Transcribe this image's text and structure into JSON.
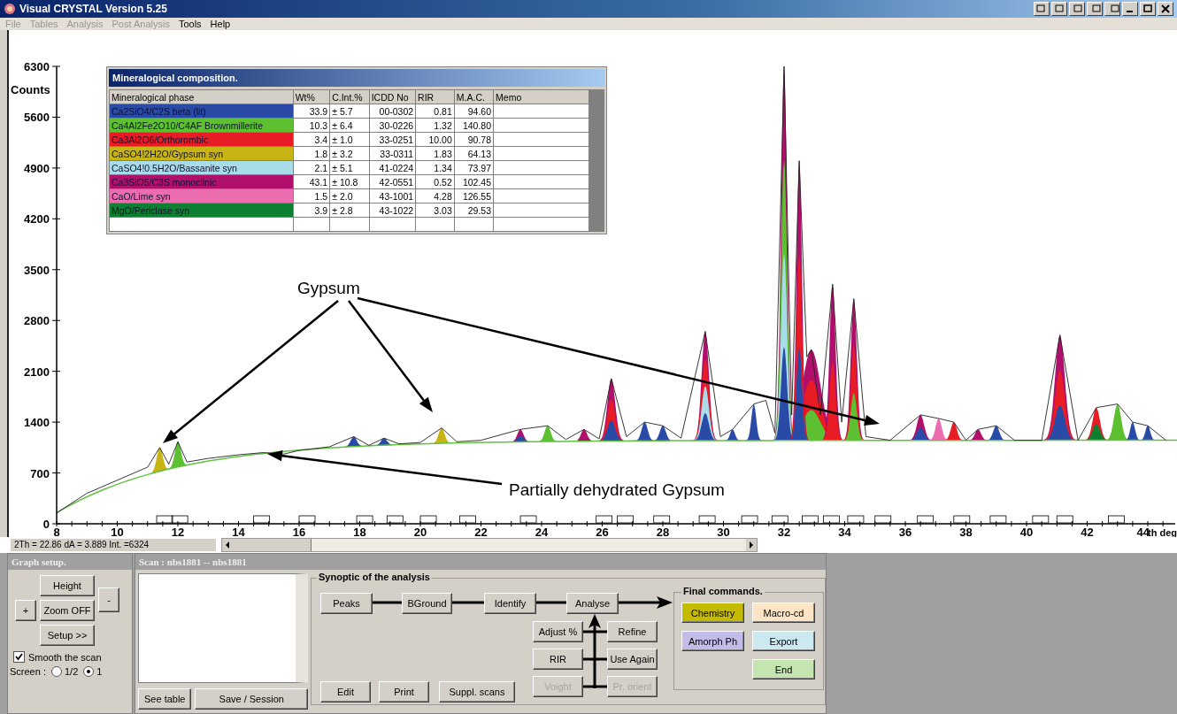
{
  "window": {
    "title": "Visual CRYSTAL Version 5.25"
  },
  "menu": [
    {
      "label": "File",
      "disabled": true
    },
    {
      "label": "Tables",
      "disabled": true
    },
    {
      "label": "Analysis",
      "disabled": true
    },
    {
      "label": "Post Analysis",
      "disabled": true
    },
    {
      "label": "Tools",
      "disabled": false
    },
    {
      "label": "Help",
      "disabled": false
    }
  ],
  "chart": {
    "annotations": [
      "Gypsum",
      "Partially dehydrated Gypsum"
    ],
    "chart_data": {
      "type": "line",
      "xlabel": "th deg",
      "ylabel": "Counts",
      "xlim": [
        8,
        44.9
      ],
      "ylim": [
        0,
        6300
      ],
      "xticks": [
        8,
        10,
        12,
        14,
        16,
        18,
        20,
        22,
        24,
        26,
        28,
        30,
        32,
        34,
        36,
        38,
        40,
        42,
        44
      ],
      "yticks": [
        0,
        700,
        1400,
        2100,
        2800,
        3500,
        4200,
        4900,
        5600,
        6300
      ],
      "x": [
        8,
        9,
        10,
        11,
        11.4,
        11.7,
        12,
        12.3,
        13,
        14,
        14.8,
        15.5,
        16,
        17,
        17.8,
        18.3,
        18.8,
        19.3,
        20,
        20.7,
        21.2,
        22,
        23.3,
        24.2,
        24.8,
        25.4,
        25.9,
        26.3,
        26.8,
        27.4,
        28,
        28.6,
        29.4,
        29.9,
        30.3,
        31,
        31.4,
        31.7,
        32,
        32.25,
        32.5,
        32.75,
        32.9,
        33.2,
        33.6,
        33.9,
        34.3,
        34.7,
        35.5,
        36.5,
        37.1,
        37.6,
        38,
        38.4,
        39,
        39.6,
        40.5,
        41.1,
        41.7,
        42.3,
        43,
        43.5,
        44,
        44.6
      ],
      "series": [
        {
          "color": "#222222",
          "values": [
            150,
            420,
            600,
            780,
            1050,
            820,
            1130,
            850,
            900,
            950,
            980,
            960,
            1010,
            1060,
            1200,
            1080,
            1180,
            1100,
            1120,
            1320,
            1130,
            1150,
            1300,
            1350,
            1160,
            1300,
            1170,
            2000,
            1200,
            1400,
            1350,
            1180,
            2650,
            1200,
            1300,
            1650,
            1700,
            1250,
            6300,
            1500,
            5000,
            2300,
            2400,
            1500,
            3300,
            1400,
            3100,
            1200,
            1150,
            1500,
            1450,
            1400,
            1150,
            1300,
            1350,
            1150,
            1150,
            2600,
            1150,
            1600,
            1650,
            1400,
            1350,
            1150
          ]
        }
      ]
    }
  },
  "table": {
    "title": "Mineralogical composition.",
    "columns": [
      "Mineralogical phase",
      "Wt%",
      "C.Int.%",
      "ICDD No",
      "RIR",
      "M.A.C.",
      "Memo"
    ],
    "rows": [
      {
        "color": "#2a4aa8",
        "cells": [
          "Ca2SiO4/C2S beta (lit)",
          "33.9",
          "± 5.7",
          "00-0302",
          "0.81",
          "94.60"
        ]
      },
      {
        "color": "#5cc030",
        "cells": [
          "Ca4Al2Fe2O10/C4AF Brownmillerite",
          "10.3",
          "± 6.4",
          "30-0226",
          "1.32",
          "140.80"
        ]
      },
      {
        "color": "#e81c24",
        "cells": [
          "Ca3Al2O6/Orthorombic",
          "3.4",
          "± 1.0",
          "33-0251",
          "10.00",
          "90.78"
        ]
      },
      {
        "color": "#c8b414",
        "cells": [
          "CaSO4!2H2O/Gypsum syn",
          "1.8",
          "± 3.2",
          "33-0311",
          "1.83",
          "64.13"
        ]
      },
      {
        "color": "#a8dce8",
        "cells": [
          "CaSO4!0.5H2O/Bassanite syn",
          "2.1",
          "± 5.1",
          "41-0224",
          "1.34",
          "73.97"
        ]
      },
      {
        "color": "#b0106c",
        "cells": [
          "Ca3SiO5/C3S monoclinic",
          "43.1",
          "± 10.8",
          "42-0551",
          "0.52",
          "102.45"
        ]
      },
      {
        "color": "#ec6cb0",
        "cells": [
          "CaO/Lime syn",
          "1.5",
          "± 2.0",
          "43-1001",
          "4.28",
          "126.55"
        ]
      },
      {
        "color": "#0c8030",
        "cells": [
          "MgO/Periclase syn",
          "3.9",
          "± 2.8",
          "43-1022",
          "3.03",
          "29.53"
        ]
      }
    ]
  },
  "status": "2Th = 22.86 dA = 3.889  Int. =6324",
  "graph_setup": {
    "title": "Graph setup.",
    "height": "Height",
    "zoom": "Zoom OFF",
    "setup": "Setup >>",
    "plus": "+",
    "minus": "-",
    "smooth": {
      "label": "Smooth the scan",
      "checked": true
    },
    "screen": {
      "label": "Screen :",
      "options": [
        {
          "label": "1/2",
          "selected": false
        },
        {
          "label": "1",
          "selected": true
        }
      ]
    }
  },
  "scan": {
    "title": "Scan : nbs1881 -- nbs1881",
    "buttons": [
      "See table",
      "Save / Session"
    ],
    "synoptic": {
      "title": "Synoptic of the analysis",
      "flow": [
        "Peaks",
        "BGround",
        "Identify",
        "Analyse"
      ],
      "side": [
        {
          "label": "Adjust %",
          "disabled": false
        },
        {
          "label": "Refine",
          "disabled": false
        },
        {
          "label": "RIR",
          "disabled": false
        },
        {
          "label": "Use Again",
          "disabled": false
        },
        {
          "label": "Voight",
          "disabled": true
        },
        {
          "label": "Pr. orient",
          "disabled": true
        }
      ],
      "bottom": [
        "Edit",
        "Print",
        "Suppl. scans"
      ]
    },
    "final": {
      "title": "Final commands.",
      "buttons": [
        {
          "label": "Chemistry",
          "color": "#c4ba00"
        },
        {
          "label": "Macro-cd",
          "color": "#fce4c4"
        },
        {
          "label": "Amorph Ph",
          "color": "#c4bce8"
        },
        {
          "label": "Export",
          "color": "#cce8f0"
        },
        {
          "label": "End",
          "color": "#c4e4b0"
        }
      ]
    }
  }
}
